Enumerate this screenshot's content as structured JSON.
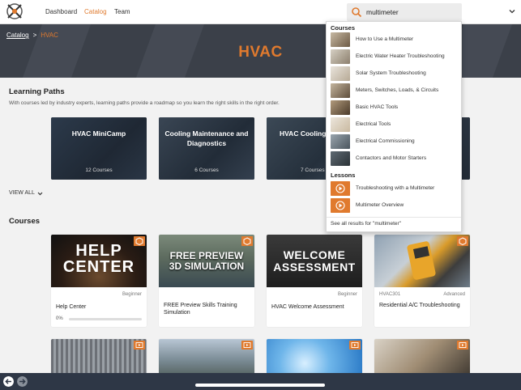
{
  "nav": {
    "links": [
      "Dashboard",
      "Catalog",
      "Team"
    ],
    "active": "Catalog"
  },
  "search": {
    "value": "multimeter"
  },
  "breadcrumb": {
    "parent": "Catalog",
    "separator": ">",
    "current": "HVAC"
  },
  "hero": {
    "title": "HVAC"
  },
  "learning_paths": {
    "title": "Learning Paths",
    "description": "With courses led by industry experts, learning paths provide a roadmap so you learn the right skills in the right order.",
    "cards": [
      {
        "title": "HVAC MiniCamp",
        "count": "12 Courses"
      },
      {
        "title": "Cooling Maintenance and Diagnostics",
        "count": "6 Courses"
      },
      {
        "title": "HVAC Cooling",
        "count": "7 Courses"
      }
    ],
    "view_all": "VIEW ALL"
  },
  "courses": {
    "title": "Courses",
    "items": [
      {
        "image_text": "HELP CENTER",
        "level": "Beginner",
        "code": "",
        "title": "Help Center",
        "progress_label": "0%",
        "progress": 0
      },
      {
        "image_text": "FREE PREVIEW 3D SIMULATION",
        "level": "",
        "code": "",
        "title": "FREE Preview Skills Training Simulation"
      },
      {
        "image_text": "WELCOME ASSESSMENT",
        "level": "Beginner",
        "code": "",
        "title": "HVAC Welcome Assessment"
      },
      {
        "image_text": "",
        "level": "Advanced",
        "code": "HVAC301",
        "title": "Residential A/C Troubleshooting"
      }
    ]
  },
  "dropdown": {
    "courses_heading": "Courses",
    "courses": [
      "How to Use a Multimeter",
      "Electric Water Heater Troubleshooting",
      "Solar System Troubleshooting",
      "Meters, Switches, Loads, & Circuits",
      "Basic HVAC Tools",
      "Electrical Tools",
      "Electrical Commissioning",
      "Contactors and Motor Starters"
    ],
    "lessons_heading": "Lessons",
    "lessons": [
      "Troubleshooting with a Multimeter",
      "Multimeter Overview"
    ],
    "footer": "See all results for \"multimeter\""
  },
  "colors": {
    "accent": "#e07a2e",
    "dark": "#2e3746",
    "hero": "#3b4049"
  },
  "icons": {
    "logo": "hvac-logo-icon",
    "search": "search-icon",
    "back": "back-arrow-icon",
    "forward": "forward-arrow-icon"
  }
}
